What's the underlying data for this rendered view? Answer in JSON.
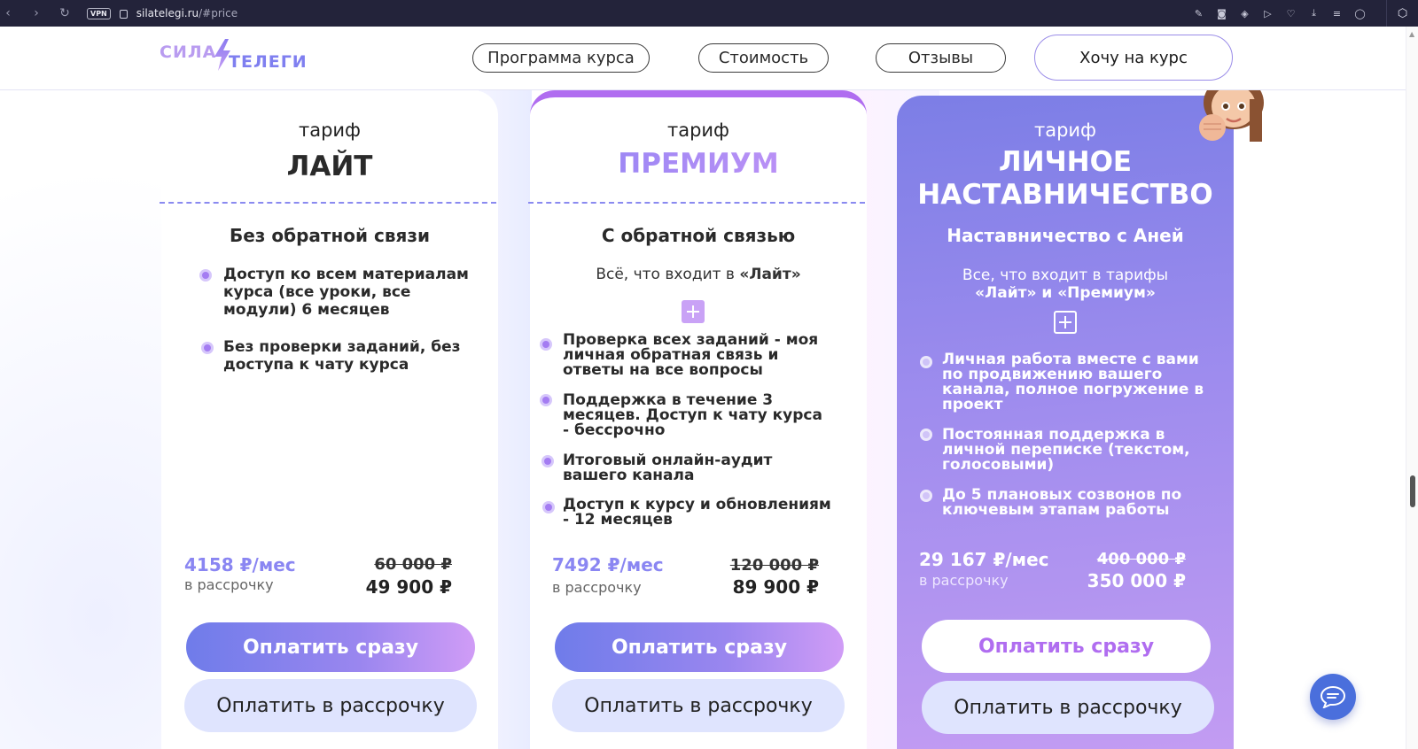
{
  "browser": {
    "vpn_label": "VPN",
    "url_domain": "silatelegi.ru",
    "url_path": "/#price"
  },
  "header": {
    "logo_line1": "СИЛА",
    "logo_line2": "ТЕЛЕГИ",
    "nav": [
      {
        "label": "Программа курса"
      },
      {
        "label": "Стоимость"
      },
      {
        "label": "Отзывы"
      }
    ],
    "cta_label": "Хочу на курс"
  },
  "plans": [
    {
      "tariff_label": "тариф",
      "name": "ЛАЙТ",
      "subtitle": "Без обратной связи",
      "features": [
        "Доступ ко всем материалам курса (все уроки, все модули) 6 месяцев",
        "Без проверки заданий, без доступа к чату курса"
      ],
      "monthly": "4158 ₽/мес",
      "installment_label": "в рассрочку",
      "old_price": "60 000 ₽",
      "price": "49 900 ₽",
      "pay_now": "Оплатить сразу",
      "pay_installment": "Оплатить в рассрочку"
    },
    {
      "tariff_label": "тариф",
      "name": "ПРЕМИУМ",
      "subtitle": "С обратной связью",
      "includes_prefix": "Всё, что входит в ",
      "includes_bold": "«Лайт»",
      "features": [
        "Проверка всех заданий - моя личная обратная связь и ответы на все вопросы",
        "Поддержка в течение 3 месяцев. Доступ к чату курса - бессрочно",
        "Итоговый онлайн-аудит вашего канала",
        "Доступ к курсу и обновлениям - 12 месяцев"
      ],
      "monthly": "7492 ₽/мес",
      "installment_label": "в рассрочку",
      "old_price": "120 000 ₽",
      "price": "89 900 ₽",
      "pay_now": "Оплатить сразу",
      "pay_installment": "Оплатить в рассрочку"
    },
    {
      "tariff_label": "тариф",
      "name_line1": "ЛИЧНОЕ",
      "name_line2": "НАСТАВНИЧЕСТВО",
      "subtitle": "Наставничество с Аней",
      "includes_line1": "Все, что входит в тарифы",
      "includes_line2": "«Лайт» и «Премиум»",
      "features": [
        "Личная работа вместе с вами по продвижению вашего канала, полное погружение в проект",
        "Постоянная поддержка в личной переписке (текстом, голосовыми)",
        "До 5 плановых созвонов по ключевым этапам работы"
      ],
      "monthly": "29 167 ₽/мес",
      "installment_label": "в рассрочку",
      "old_price": "400 000 ₽",
      "price": "350 000 ₽",
      "pay_now": "Оплатить сразу",
      "pay_installment": "Оплатить в рассрочку"
    }
  ],
  "colors": {
    "accent": "#8a86f2",
    "premium_border": "#b06df0",
    "personal_gradient_start": "#7c7ee6",
    "personal_gradient_end": "#c39cf2",
    "installment_button": "#dfe4fe",
    "chat_button": "#4a6fdc"
  },
  "icons": {
    "chat": "chat-bubble-icon",
    "avatar": "avatar-memoji-icon"
  }
}
